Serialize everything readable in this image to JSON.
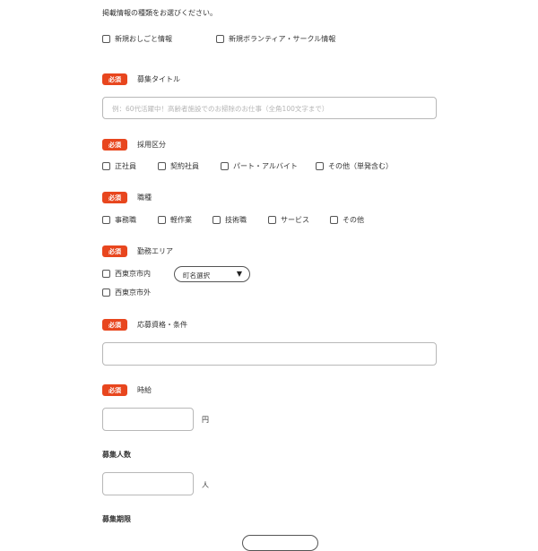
{
  "listing_type": {
    "heading": "掲載情報の種類をお選びください。",
    "options": [
      "新規おしごと情報",
      "新規ボランティア・サークル情報"
    ]
  },
  "required_badge": "必須",
  "recruit_title": {
    "label": "募集タイトル",
    "placeholder": "例：60代活躍中！高齢者施設でのお掃除のお仕事（全角100文字まで）"
  },
  "employment_type": {
    "label": "採用区分",
    "options": [
      "正社員",
      "契約社員",
      "パート・アルバイト",
      "その他（単発含む）"
    ]
  },
  "job_type": {
    "label": "職種",
    "options": [
      "事務職",
      "軽作業",
      "技術職",
      "サービス",
      "その他"
    ]
  },
  "work_area": {
    "label": "勤務エリア",
    "options": [
      "西東京市内",
      "西東京市外"
    ],
    "town_select": "町名選択"
  },
  "qualification": {
    "label": "応募資格・条件"
  },
  "hourly_wage": {
    "label": "時給",
    "unit": "円"
  },
  "headcount": {
    "label": "募集人数",
    "unit": "人"
  },
  "period": {
    "label": "募集期限"
  },
  "colors": {
    "accent": "#e8461e",
    "border": "#b8b8b8"
  }
}
